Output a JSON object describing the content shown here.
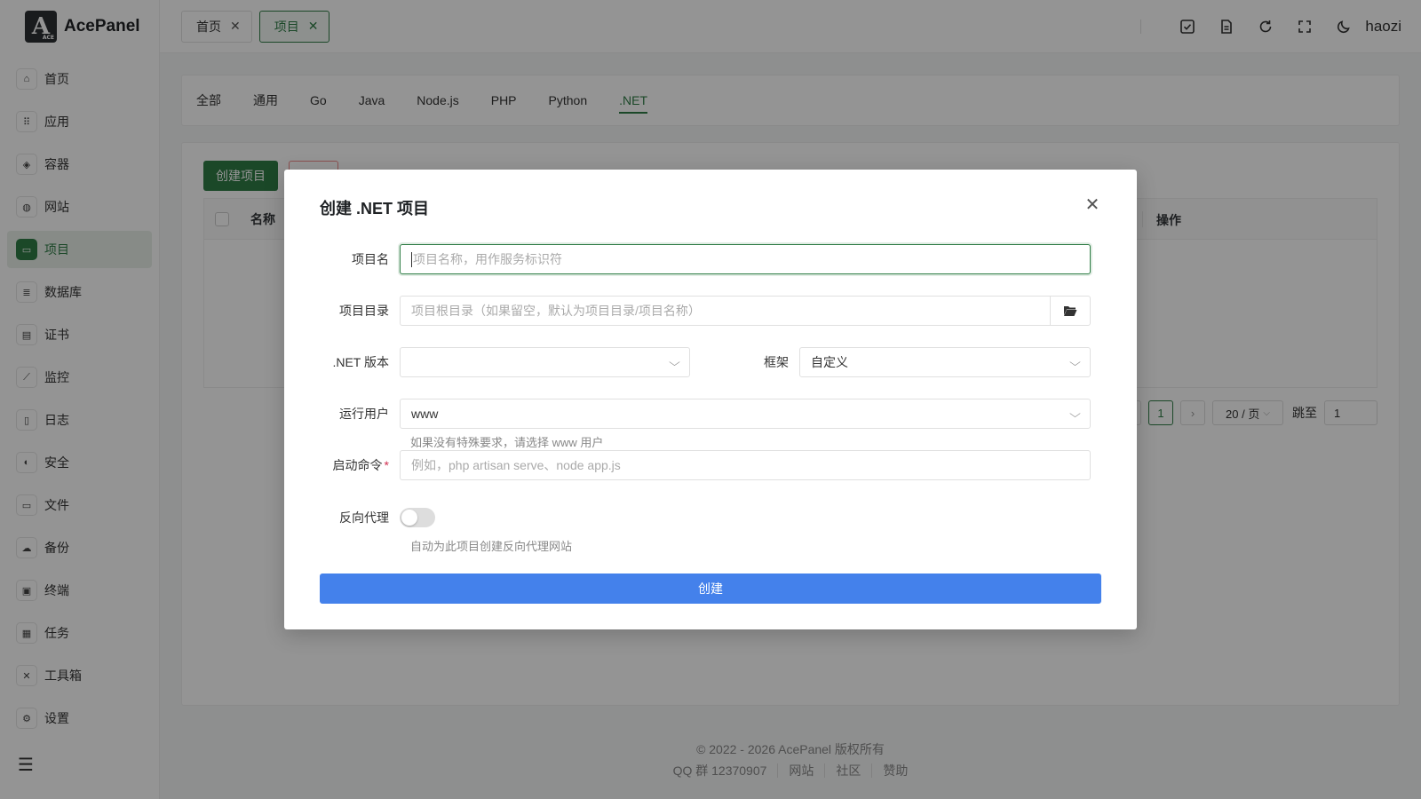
{
  "app": {
    "logo_mark": "A",
    "logo_sub": "ACE",
    "name": "AcePanel"
  },
  "sidebar": {
    "items": [
      {
        "label": "首页",
        "icon": "⌂"
      },
      {
        "label": "应用",
        "icon": "⠿"
      },
      {
        "label": "容器",
        "icon": "◈"
      },
      {
        "label": "网站",
        "icon": "◍"
      },
      {
        "label": "项目",
        "icon": "▭"
      },
      {
        "label": "数据库",
        "icon": "≣"
      },
      {
        "label": "证书",
        "icon": "▤"
      },
      {
        "label": "监控",
        "icon": "⟋"
      },
      {
        "label": "日志",
        "icon": "▯"
      },
      {
        "label": "安全",
        "icon": "◐"
      },
      {
        "label": "文件",
        "icon": "▭"
      },
      {
        "label": "备份",
        "icon": "☁"
      },
      {
        "label": "终端",
        "icon": "▣"
      },
      {
        "label": "任务",
        "icon": "▦"
      },
      {
        "label": "工具箱",
        "icon": "✕"
      },
      {
        "label": "设置",
        "icon": "⚙"
      }
    ],
    "collapse_icon": "☰"
  },
  "header": {
    "tabs": [
      {
        "label": "首页"
      },
      {
        "label": "项目"
      }
    ],
    "close_glyph": "✕",
    "username": "haozi"
  },
  "filter_tabs": [
    "全部",
    "通用",
    "Go",
    "Java",
    "Node.js",
    "PHP",
    "Python",
    ".NET"
  ],
  "toolbar": {
    "create_label": "创建项目"
  },
  "table": {
    "col_name": "名称",
    "col_ops": "操作"
  },
  "pagination": {
    "current": "1",
    "page_size": "20 / 页",
    "jump_label": "跳至",
    "jump_value": "1"
  },
  "footer": {
    "copyright": "© 2022 - 2026 AcePanel 版权所有",
    "links": [
      "QQ 群 12370907",
      "网站",
      "社区",
      "赞助"
    ]
  },
  "modal": {
    "title": "创建 .NET 项目",
    "name": {
      "label": "项目名",
      "placeholder": "项目名称，用作服务标识符"
    },
    "dir": {
      "label": "项目目录",
      "placeholder": "项目根目录（如果留空，默认为项目目录/项目名称）"
    },
    "version": {
      "label": ".NET 版本",
      "value": ""
    },
    "framework": {
      "label": "框架",
      "value": "自定义"
    },
    "user": {
      "label": "运行用户",
      "value": "www",
      "hint": "如果没有特殊要求，请选择 www 用户"
    },
    "command": {
      "label": "启动命令",
      "required": "*",
      "placeholder": "例如，php artisan serve、node app.js"
    },
    "proxy": {
      "label": "反向代理",
      "enabled": false,
      "hint": "自动为此项目创建反向代理网站"
    },
    "submit_label": "创建"
  }
}
